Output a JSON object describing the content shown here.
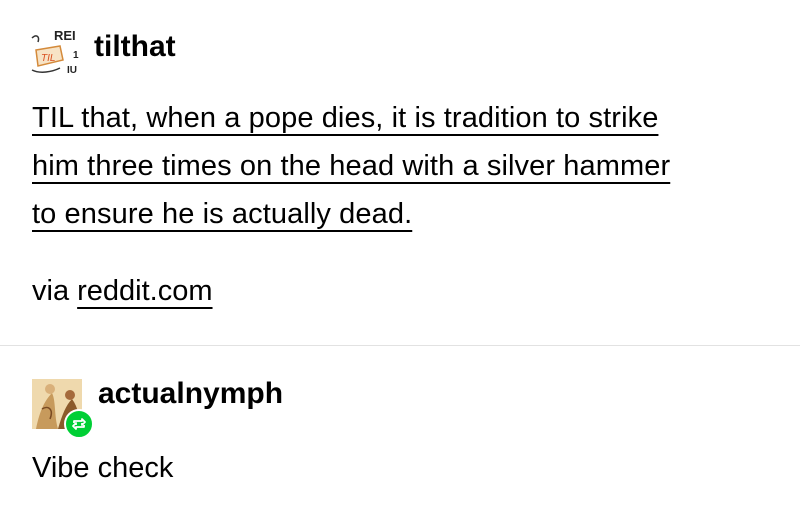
{
  "original_post": {
    "username": "tilthat",
    "avatar_text": "TIL",
    "body_lines": [
      "TIL that, when a pope dies, it is tradition to strike",
      "him three times on the head with a silver hammer",
      "to ensure he is actually dead."
    ],
    "via_label": "via",
    "via_link": "reddit.com"
  },
  "reblog": {
    "username": "actualnymph",
    "badge_icon": "reblog-icon",
    "text": "Vibe check"
  },
  "colors": {
    "reblog_badge": "#00cf35",
    "divider": "#e2e2e2"
  }
}
